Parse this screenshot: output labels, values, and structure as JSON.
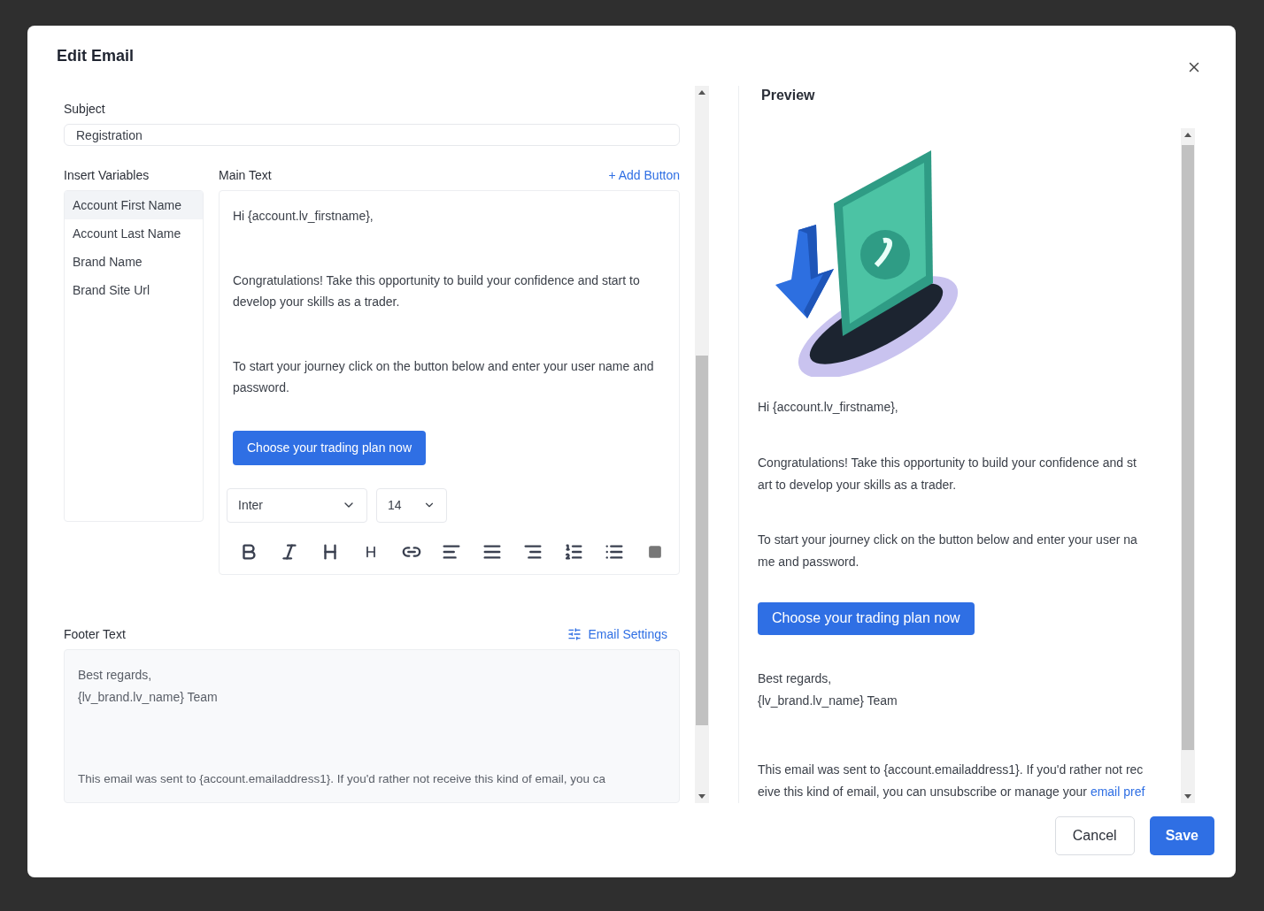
{
  "dialog": {
    "title": "Edit Email"
  },
  "subject": {
    "label": "Subject",
    "value": "Registration"
  },
  "variables": {
    "label": "Insert Variables",
    "items": [
      {
        "label": "Account First Name",
        "selected": true
      },
      {
        "label": "Account Last Name",
        "selected": false
      },
      {
        "label": "Brand Name",
        "selected": false
      },
      {
        "label": "Brand Site Url",
        "selected": false
      }
    ]
  },
  "main_text": {
    "label": "Main Text",
    "add_button": "+ Add Button",
    "paragraphs": [
      "Hi {account.lv_firstname},",
      "Congratulations! Take this opportunity to build your confidence and start to develop your skills as a trader.",
      "To start your journey click on the button below and enter your user name and password."
    ],
    "cta": "Choose your trading plan now",
    "font": "Inter",
    "size": "14"
  },
  "footer_text": {
    "label": "Footer Text",
    "settings_link": "Email Settings",
    "lines": [
      "Best regards,",
      "{lv_brand.lv_name} Team"
    ],
    "notice": "This email was sent to {account.emailaddress1}. If you'd rather not receive this kind of email, you ca"
  },
  "preview": {
    "title": "Preview",
    "greeting": "Hi {account.lv_firstname},",
    "paragraphs": [
      [
        "Congratulations! Take this opportunity to build your confidence and st",
        "art to develop your skills as a trader."
      ],
      [
        "To start your journey click on the button below and enter your user na",
        "me and password."
      ]
    ],
    "cta": "Choose your trading plan now",
    "signoff": [
      "Best regards,",
      "{lv_brand.lv_name} Team"
    ],
    "notice": [
      "This email was sent to {account.emailaddress1}. If you'd rather not rec",
      "eive this kind of email, you can unsubscribe or manage your "
    ],
    "notice_link": "email pref"
  },
  "buttons": {
    "cancel": "Cancel",
    "save": "Save"
  }
}
